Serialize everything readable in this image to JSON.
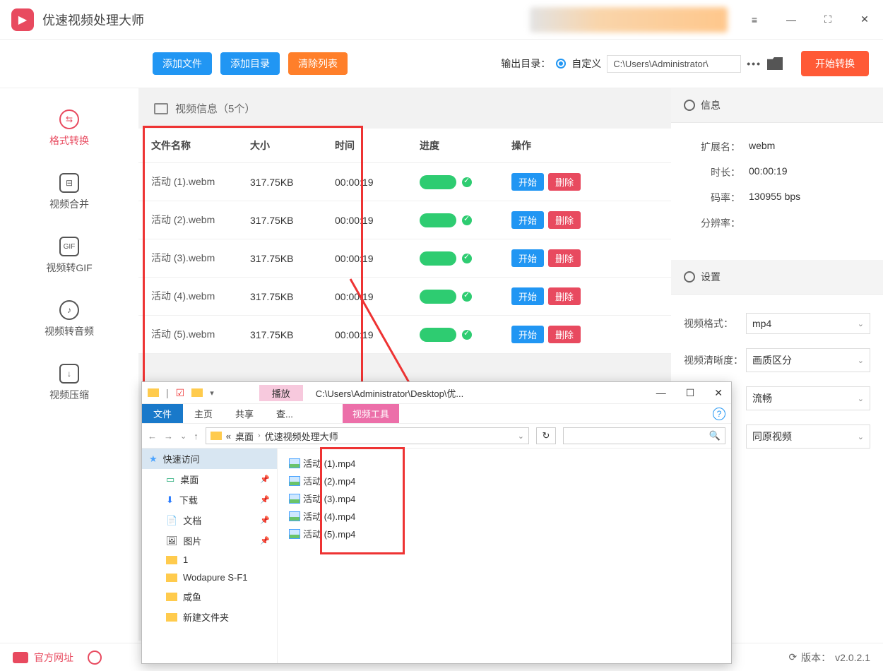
{
  "app": {
    "title": "优速视频处理大师"
  },
  "titlebar": {
    "menu_icon": "menu",
    "minimize": "—",
    "maximize": "⛶",
    "close": "✕"
  },
  "toolbar": {
    "add_file": "添加文件",
    "add_dir": "添加目录",
    "clear_list": "清除列表",
    "output_dir_label": "输出目录：",
    "output_mode": "自定义",
    "output_path": "C:\\Users\\Administrator\\",
    "start_convert": "开始转换"
  },
  "sidebar": {
    "items": [
      {
        "label": "格式转换"
      },
      {
        "label": "视频合并"
      },
      {
        "label": "视频转GIF"
      },
      {
        "label": "视频转音频"
      },
      {
        "label": "视频压缩"
      }
    ],
    "gif_badge": "GIF"
  },
  "panel": {
    "header": "视频信息（5个）",
    "columns": {
      "name": "文件名称",
      "size": "大小",
      "time": "时间",
      "progress": "进度",
      "ops": "操作"
    },
    "ops_start": "开始",
    "ops_delete": "删除",
    "rows": [
      {
        "name": "活动 (1).webm",
        "size": "317.75KB",
        "time": "00:00:19"
      },
      {
        "name": "活动 (2).webm",
        "size": "317.75KB",
        "time": "00:00:19"
      },
      {
        "name": "活动 (3).webm",
        "size": "317.75KB",
        "time": "00:00:19"
      },
      {
        "name": "活动 (4).webm",
        "size": "317.75KB",
        "time": "00:00:19"
      },
      {
        "name": "活动 (5).webm",
        "size": "317.75KB",
        "time": "00:00:19"
      }
    ]
  },
  "info": {
    "title": "信息",
    "ext_label": "扩展名：",
    "ext": "webm",
    "dur_label": "时长：",
    "dur": "00:00:19",
    "bitrate_label": "码率：",
    "bitrate": "130955 bps",
    "res_label": "分辨率："
  },
  "settings": {
    "title": "设置",
    "video_format_label": "视频格式：",
    "video_format": "mp4",
    "video_quality_label": "视频清晰度：",
    "video_quality": "画质区分",
    "smooth": "流畅",
    "same_as_source": "同原视频"
  },
  "statusbar": {
    "official_site": "官方网址",
    "version_label": "版本：",
    "version": "v2.0.2.1"
  },
  "explorer": {
    "play_tab": "播放",
    "window_title": "C:\\Users\\Administrator\\Desktop\\优...",
    "ribbon": {
      "file": "文件",
      "home": "主页",
      "share": "共享",
      "view": "查...",
      "video_tools": "视频工具"
    },
    "crumbs": {
      "pre": "«",
      "desktop": "桌面",
      "folder": "优速视频处理大师"
    },
    "side": {
      "quick": "快速访问",
      "desktop": "桌面",
      "downloads": "下载",
      "documents": "文档",
      "pictures": "图片",
      "one": "1",
      "wodapure": "Wodapure S-F1",
      "xianyu": "咸鱼",
      "newfolder": "新建文件夹"
    },
    "files": [
      {
        "name": "活动 (1).mp4"
      },
      {
        "name": "活动 (2).mp4"
      },
      {
        "name": "活动 (3).mp4"
      },
      {
        "name": "活动 (4).mp4"
      },
      {
        "name": "活动 (5).mp4"
      }
    ]
  }
}
